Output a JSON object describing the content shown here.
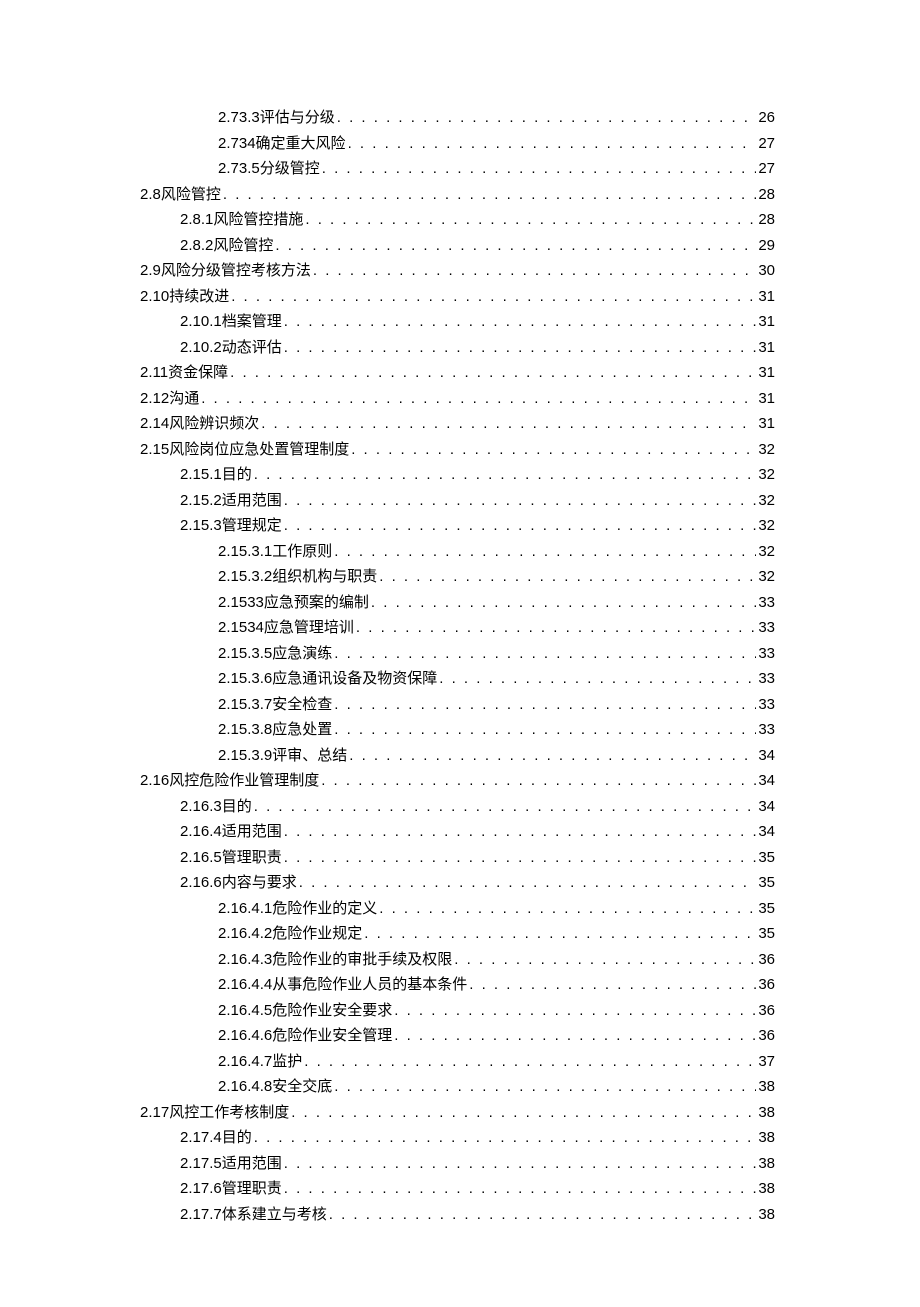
{
  "toc": [
    {
      "indent": 3,
      "num": "2.73.3",
      "sep": "   ",
      "title": "评估与分级",
      "page": "26"
    },
    {
      "indent": 3,
      "num": "2.734",
      "sep": " ",
      "title": "确定重大风险",
      "page": "27"
    },
    {
      "indent": 3,
      "num": "2.73.5",
      "sep": " ",
      "title": "分级管控",
      "page": "27"
    },
    {
      "indent": 1,
      "num": "2.8",
      "sep": "   ",
      "title": "风险管控",
      "page": "28"
    },
    {
      "indent": 2,
      "num": "2.8.1",
      "sep": "   ",
      "title": "风险管控措施",
      "page": "28"
    },
    {
      "indent": 2,
      "num": "2.8.2",
      "sep": "   ",
      "title": "风险管控",
      "page": "29"
    },
    {
      "indent": 1,
      "num": "2.9",
      "sep": "   ",
      "title": "风险分级管控考核方法",
      "page": "30"
    },
    {
      "indent": 1,
      "num": "2.10",
      "sep": "   ",
      "title": "持续改进",
      "page": "31"
    },
    {
      "indent": 2,
      "num": "2.10.1",
      "sep": "   ",
      "title": "档案管理",
      "page": "31"
    },
    {
      "indent": 2,
      "num": "2.10.2",
      "sep": "   ",
      "title": "动态评估",
      "page": "31"
    },
    {
      "indent": 1,
      "num": "2.11",
      "sep": "   ",
      "title": "资金保障",
      "page": "31"
    },
    {
      "indent": 1,
      "num": "2.12",
      "sep": "   ",
      "title": "沟通",
      "page": "31"
    },
    {
      "indent": 1,
      "num": "2.14",
      "sep": "   ",
      "title": "风险辨识频次",
      "page": "31"
    },
    {
      "indent": 1,
      "num": "2.15",
      "sep": "   ",
      "title": "风险岗位应急处置管理制度",
      "page": "32"
    },
    {
      "indent": 2,
      "num": "2.15.1",
      "sep": "   ",
      "title": "目的",
      "page": "32"
    },
    {
      "indent": 2,
      "num": "2.15.2",
      "sep": "   ",
      "title": "适用范围",
      "page": "32"
    },
    {
      "indent": 2,
      "num": "2.15.3",
      "sep": "   ",
      "title": "管理规定",
      "page": "32"
    },
    {
      "indent": 3,
      "num": "2.15.3.1",
      "sep": "   ",
      "title": "工作原则",
      "page": "32"
    },
    {
      "indent": 3,
      "num": "2.15.3.2",
      "sep": "   ",
      "title": "组织机构与职责",
      "page": "32"
    },
    {
      "indent": 3,
      "num": "2.1533",
      "sep": " ",
      "title": "应急预案的编制",
      "page": "33"
    },
    {
      "indent": 3,
      "num": "2.1534",
      "sep": " ",
      "title": "应急管理培训",
      "page": "33"
    },
    {
      "indent": 3,
      "num": "2.15.3.5",
      "sep": "   ",
      "title": "应急演练",
      "page": "33"
    },
    {
      "indent": 3,
      "num": "2.15.3.6",
      "sep": "   ",
      "title": "应急通讯设备及物资保障",
      "page": "33"
    },
    {
      "indent": 3,
      "num": "2.15.3.7",
      "sep": "   ",
      "title": "安全检查",
      "page": "33"
    },
    {
      "indent": 3,
      "num": "2.15.3.8",
      "sep": "   ",
      "title": "应急处置",
      "page": "33"
    },
    {
      "indent": 3,
      "num": "2.15.3.9",
      "sep": "   ",
      "title": "评审、总结",
      "page": "34"
    },
    {
      "indent": 1,
      "num": "2.16",
      "sep": "   ",
      "title": "风控危险作业管理制度",
      "page": "34"
    },
    {
      "indent": 2,
      "num": "2.16.3",
      "sep": "   ",
      "title": "目的",
      "page": "34"
    },
    {
      "indent": 2,
      "num": "2.16.4",
      "sep": "   ",
      "title": "适用范围",
      "page": "34"
    },
    {
      "indent": 2,
      "num": "2.16.5",
      "sep": "   ",
      "title": "管理职责",
      "page": "35"
    },
    {
      "indent": 2,
      "num": "2.16.6",
      "sep": "   ",
      "title": "内容与要求",
      "page": "35"
    },
    {
      "indent": 3,
      "num": "2.16.4.1",
      "sep": "   ",
      "title": "危险作业的定义",
      "page": "35"
    },
    {
      "indent": 3,
      "num": "2.16.4.2",
      "sep": "   ",
      "title": "危险作业规定",
      "page": "35"
    },
    {
      "indent": 3,
      "num": "2.16.4.3",
      "sep": "   ",
      "title": "危险作业的审批手续及权限",
      "page": "36"
    },
    {
      "indent": 3,
      "num": "2.16.4.4",
      "sep": "   ",
      "title": "从事危险作业人员的基本条件",
      "page": "36"
    },
    {
      "indent": 3,
      "num": "2.16.4.5",
      "sep": "   ",
      "title": "危险作业安全要求",
      "page": "36"
    },
    {
      "indent": 3,
      "num": "2.16.4.6",
      "sep": "   ",
      "title": "危险作业安全管理",
      "page": "36"
    },
    {
      "indent": 3,
      "num": "2.16.4.7",
      "sep": "   ",
      "title": "监护",
      "page": "37"
    },
    {
      "indent": 3,
      "num": "2.16.4.8",
      "sep": "   ",
      "title": "安全交底",
      "page": "38"
    },
    {
      "indent": 1,
      "num": "2.17",
      "sep": "   ",
      "title": "风控工作考核制度",
      "page": "38"
    },
    {
      "indent": 2,
      "num": "2.17.4",
      "sep": "   ",
      "title": "目的",
      "page": "38"
    },
    {
      "indent": 2,
      "num": "2.17.5",
      "sep": "   ",
      "title": "适用范围",
      "page": "38"
    },
    {
      "indent": 2,
      "num": "2.17.6",
      "sep": "   ",
      "title": "管理职责",
      "page": "38"
    },
    {
      "indent": 2,
      "num": "2.17.7",
      "sep": "   ",
      "title": "体系建立与考核",
      "page": "38"
    }
  ]
}
